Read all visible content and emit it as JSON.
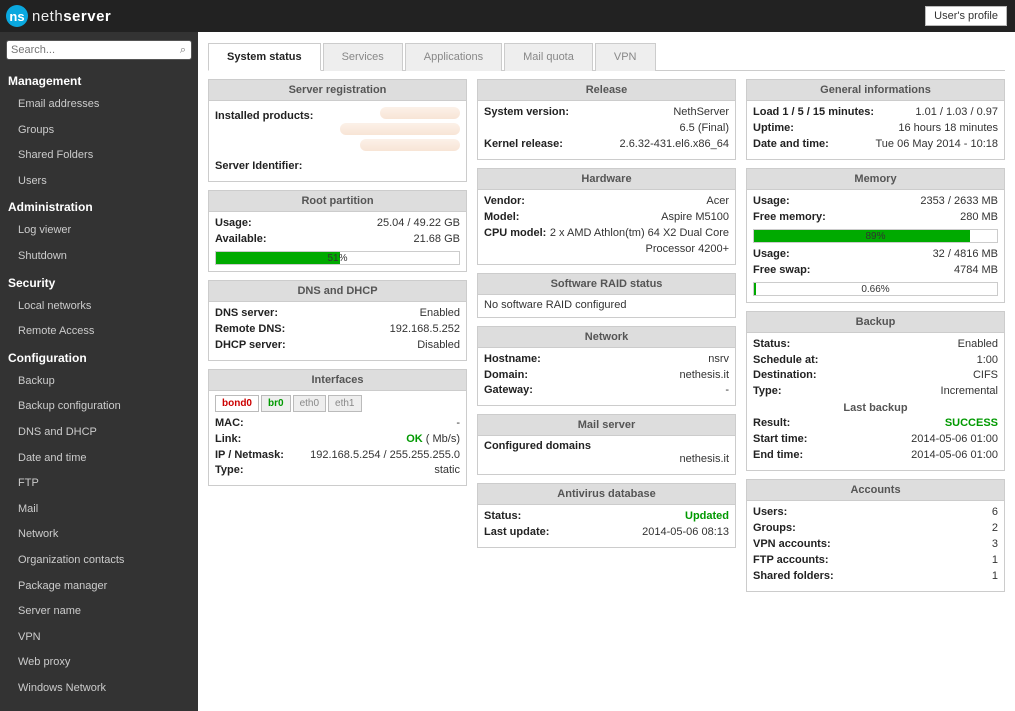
{
  "brand": {
    "name_light": "neth",
    "name_bold": "server",
    "icon_text": "ns"
  },
  "header": {
    "profile_button": "User's profile"
  },
  "search": {
    "placeholder": "Search..."
  },
  "nav": {
    "sections": [
      {
        "title": "Management",
        "items": [
          "Email addresses",
          "Groups",
          "Shared Folders",
          "Users"
        ]
      },
      {
        "title": "Administration",
        "items": [
          "Log viewer",
          "Shutdown"
        ]
      },
      {
        "title": "Security",
        "items": [
          "Local networks",
          "Remote Access"
        ]
      },
      {
        "title": "Configuration",
        "items": [
          "Backup",
          "Backup configuration",
          "DNS and DHCP",
          "Date and time",
          "FTP",
          "Mail",
          "Network",
          "Organization contacts",
          "Package manager",
          "Server name",
          "VPN",
          "Web proxy",
          "Windows Network"
        ]
      }
    ]
  },
  "tabs": [
    "System status",
    "Services",
    "Applications",
    "Mail quota",
    "VPN"
  ],
  "server_registration": {
    "title": "Server registration",
    "installed_label": "Installed products:",
    "identifier_label": "Server Identifier:"
  },
  "root_partition": {
    "title": "Root partition",
    "usage_label": "Usage:",
    "usage_value": "25.04 / 49.22 GB",
    "available_label": "Available:",
    "available_value": "21.68 GB",
    "percent": 51,
    "percent_text": "51%"
  },
  "dns_dhcp": {
    "title": "DNS and DHCP",
    "rows": [
      {
        "k": "DNS server:",
        "v": "Enabled"
      },
      {
        "k": "Remote DNS:",
        "v": "192.168.5.252"
      },
      {
        "k": "DHCP server:",
        "v": "Disabled"
      }
    ]
  },
  "interfaces": {
    "title": "Interfaces",
    "tabs": [
      "bond0",
      "br0",
      "eth0",
      "eth1"
    ],
    "rows": [
      {
        "k": "MAC:",
        "v": "-"
      },
      {
        "k": "Link:",
        "v": "OK",
        "extra": " ( Mb/s)",
        "ok": true
      },
      {
        "k": "IP / Netmask:",
        "v": "192.168.5.254 / 255.255.255.0"
      },
      {
        "k": "Type:",
        "v": "static"
      }
    ]
  },
  "release": {
    "title": "Release",
    "rows": [
      {
        "k": "System version:",
        "v": "NethServer",
        "extra": "6.5 (Final)"
      },
      {
        "k": "Kernel release:",
        "v": "2.6.32-431.el6.x86_64"
      }
    ]
  },
  "hardware": {
    "title": "Hardware",
    "rows": [
      {
        "k": "Vendor:",
        "v": "Acer"
      },
      {
        "k": "Model:",
        "v": "Aspire M5100"
      },
      {
        "k": "CPU model:",
        "v": "2 x AMD Athlon(tm) 64 X2 Dual Core Processor 4200+"
      }
    ]
  },
  "raid": {
    "title": "Software RAID status",
    "text": "No software RAID configured"
  },
  "network": {
    "title": "Network",
    "rows": [
      {
        "k": "Hostname:",
        "v": "nsrv"
      },
      {
        "k": "Domain:",
        "v": "nethesis.it"
      },
      {
        "k": "Gateway:",
        "v": "-"
      }
    ]
  },
  "mail": {
    "title": "Mail server",
    "configured_label": "Configured domains",
    "domain": "nethesis.it"
  },
  "antivirus": {
    "title": "Antivirus database",
    "status_label": "Status:",
    "status_value": "Updated",
    "last_label": "Last update:",
    "last_value": "2014-05-06 08:13"
  },
  "general": {
    "title": "General informations",
    "rows": [
      {
        "k": "Load 1 / 5 / 15 minutes:",
        "v": "1.01 / 1.03 / 0.97"
      },
      {
        "k": "Uptime:",
        "v": "16 hours 18 minutes"
      },
      {
        "k": "Date and time:",
        "v": "Tue 06 May 2014 - 10:18"
      }
    ]
  },
  "memory": {
    "title": "Memory",
    "ram_rows": [
      {
        "k": "Usage:",
        "v": "2353 / 2633 MB"
      },
      {
        "k": "Free memory:",
        "v": "280 MB"
      }
    ],
    "ram_percent": 89,
    "ram_percent_text": "89%",
    "swap_rows": [
      {
        "k": "Usage:",
        "v": "32 / 4816 MB"
      },
      {
        "k": "Free swap:",
        "v": "4784 MB"
      }
    ],
    "swap_percent": 0.66,
    "swap_percent_text": "0.66%"
  },
  "backup": {
    "title": "Backup",
    "rows": [
      {
        "k": "Status:",
        "v": "Enabled"
      },
      {
        "k": "Schedule at:",
        "v": "1:00"
      },
      {
        "k": "Destination:",
        "v": "CIFS"
      },
      {
        "k": "Type:",
        "v": "Incremental"
      }
    ],
    "last_title": "Last backup",
    "last_rows": [
      {
        "k": "Result:",
        "v": "SUCCESS",
        "ok": true
      },
      {
        "k": "Start time:",
        "v": "2014-05-06 01:00"
      },
      {
        "k": "End time:",
        "v": "2014-05-06 01:00"
      }
    ]
  },
  "accounts": {
    "title": "Accounts",
    "rows": [
      {
        "k": "Users:",
        "v": "6"
      },
      {
        "k": "Groups:",
        "v": "2"
      },
      {
        "k": "VPN accounts:",
        "v": "3"
      },
      {
        "k": "FTP accounts:",
        "v": "1"
      },
      {
        "k": "Shared folders:",
        "v": "1"
      }
    ]
  }
}
